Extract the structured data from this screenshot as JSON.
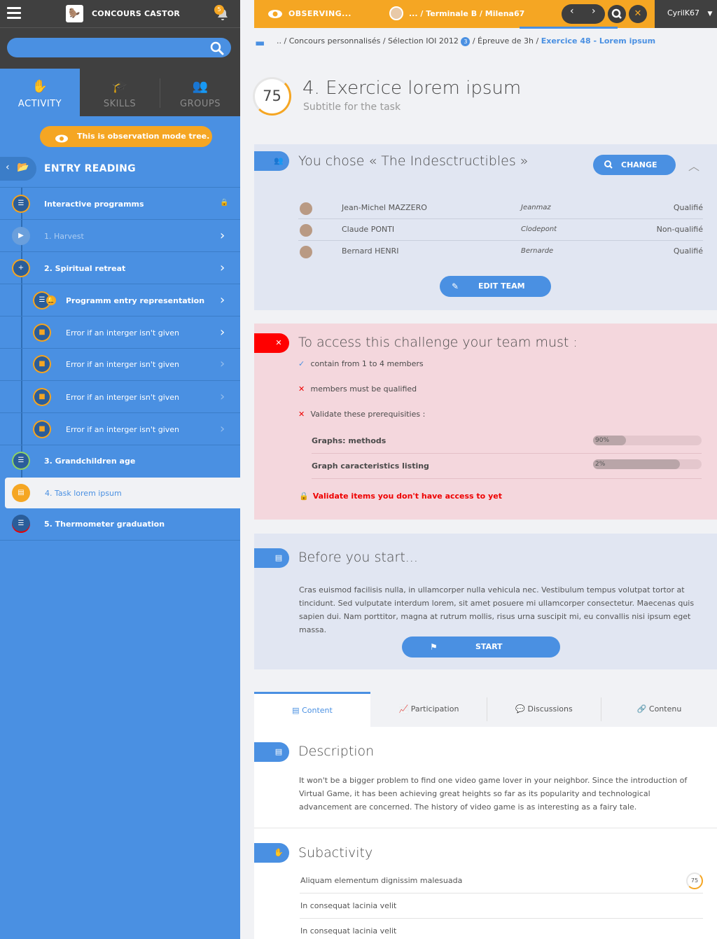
{
  "sidebar": {
    "brand": "CONCOURS CASTOR",
    "notifications": "5",
    "search_placeholder": "",
    "tabs": [
      {
        "label": "ACTIVITY"
      },
      {
        "label": "SKILLS"
      },
      {
        "label": "GROUPS"
      }
    ],
    "observation_notice": "This is observation mode tree.",
    "entry_title": "ENTRY READING",
    "tree": [
      {
        "label": "Interactive programms"
      },
      {
        "label": "1. Harvest"
      },
      {
        "label": "2. Spiritual retreat"
      },
      {
        "label": "Programm entry representation"
      },
      {
        "label": "Error if an interger isn't given"
      },
      {
        "label": "Error if an interger isn't given"
      },
      {
        "label": "Error if an interger isn't given"
      },
      {
        "label": "Error if an interger isn't given"
      },
      {
        "label": "3. Grandchildren age"
      },
      {
        "label": "4. Task lorem ipsum"
      },
      {
        "label": "5. Thermometer graduation"
      }
    ]
  },
  "topbar": {
    "observing": "OBSERVING...",
    "crumb_user": "... / Terminale B / Milena67",
    "username": "CyrilK67"
  },
  "breadcrumb": {
    "start": ".. / Concours personnalisés / Sélection IOI 2012",
    "badge": "3",
    "middle": "/ Épreuve de 3h /",
    "current": "Exercice 48 - Lorem ipsum"
  },
  "task": {
    "score": "75",
    "title": "4. Exercice lorem ipsum",
    "subtitle": "Subtitle for the task"
  },
  "team": {
    "title": "You chose « The Indesctructibles »",
    "change_label": "CHANGE",
    "edit_label": "EDIT TEAM",
    "members": [
      {
        "name": "Jean-Michel MAZZERO",
        "nick": "Jeanmaz",
        "status": "Qualifié"
      },
      {
        "name": "Claude PONTI",
        "nick": "Clodepont",
        "status": "Non-qualifié"
      },
      {
        "name": "Bernard HENRI",
        "nick": "Bernarde",
        "status": "Qualifié"
      }
    ]
  },
  "access": {
    "title": "To access this challenge your team must :",
    "conditions": [
      {
        "mark": "✓",
        "text": "contain from 1 to 4 members"
      },
      {
        "mark": "✕",
        "text": "members must be qualified"
      },
      {
        "mark": "✕",
        "text": "Validate these prerequisities :"
      }
    ],
    "prereqs": [
      {
        "label": "Graphs: methods",
        "progress": 0.3,
        "text": "90%"
      },
      {
        "label": "Graph caracteristics listing",
        "progress": 0.8,
        "text": "2%"
      }
    ],
    "warning": "Validate items you don't have access to yet"
  },
  "before": {
    "title": "Before you start...",
    "text": "Cras euismod facilisis nulla, in ullamcorper nulla vehicula nec. Vestibulum tempus volutpat tortor at tincidunt. Sed vulputate interdum lorem, sit amet posuere mi ullamcorper consectetur. Maecenas quis sapien dui. Nam porttitor, magna at rutrum mollis, risus urna suscipit mi, eu convallis nisi ipsum eget massa.",
    "start_label": "START"
  },
  "bottom_tabs": [
    {
      "label": "Content"
    },
    {
      "label": "Participation"
    },
    {
      "label": "Discussions"
    },
    {
      "label": "Contenu"
    }
  ],
  "description": {
    "title": "Description",
    "text": "It won't be a bigger problem to find one video game lover in your neighbor. Since the introduction of Virtual Game, it has been achieving great heights so far as its popularity and technological advancement are concerned. The history of video game is as interesting as a fairy tale."
  },
  "subactivity": {
    "title": "Subactivity",
    "items": [
      {
        "label": "Aliquam elementum dignissim malesuada",
        "score": "75"
      },
      {
        "label": "In consequat lacinia velit"
      },
      {
        "label": "In consequat lacinia velit"
      }
    ]
  },
  "colors": {
    "accent": "#4a90e2",
    "warning": "#f5a623",
    "error": "#ff0000",
    "dark": "#404040"
  }
}
